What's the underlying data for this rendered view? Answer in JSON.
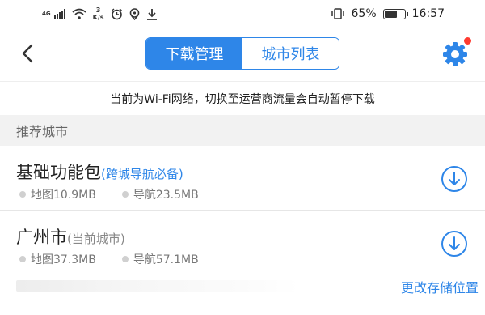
{
  "status_bar": {
    "network": "4G",
    "speed_value": "3",
    "speed_unit": "K/s",
    "battery_percent": "65%",
    "battery_level": 0.65,
    "time": "16:57",
    "icons": [
      "signal-icon",
      "wifi-icon",
      "alarm-icon",
      "location-icon",
      "download-icon",
      "vibrate-icon",
      "battery-icon"
    ]
  },
  "header": {
    "tabs": [
      {
        "label": "下载管理",
        "active": true
      },
      {
        "label": "城市列表",
        "active": false
      }
    ],
    "accent_color": "#2e86e8"
  },
  "notice": "当前为Wi-Fi网络，切换至运营商流量会自动暂停下载",
  "section_title": "推荐城市",
  "items": [
    {
      "name": "基础功能包",
      "tag": "(跨城导航必备)",
      "map": "地图10.9MB",
      "nav": "导航23.5MB"
    },
    {
      "name": "广州市",
      "tag": "(当前城市)",
      "map": "地图37.3MB",
      "nav": "导航57.1MB"
    }
  ],
  "footer_link": "更改存储位置"
}
